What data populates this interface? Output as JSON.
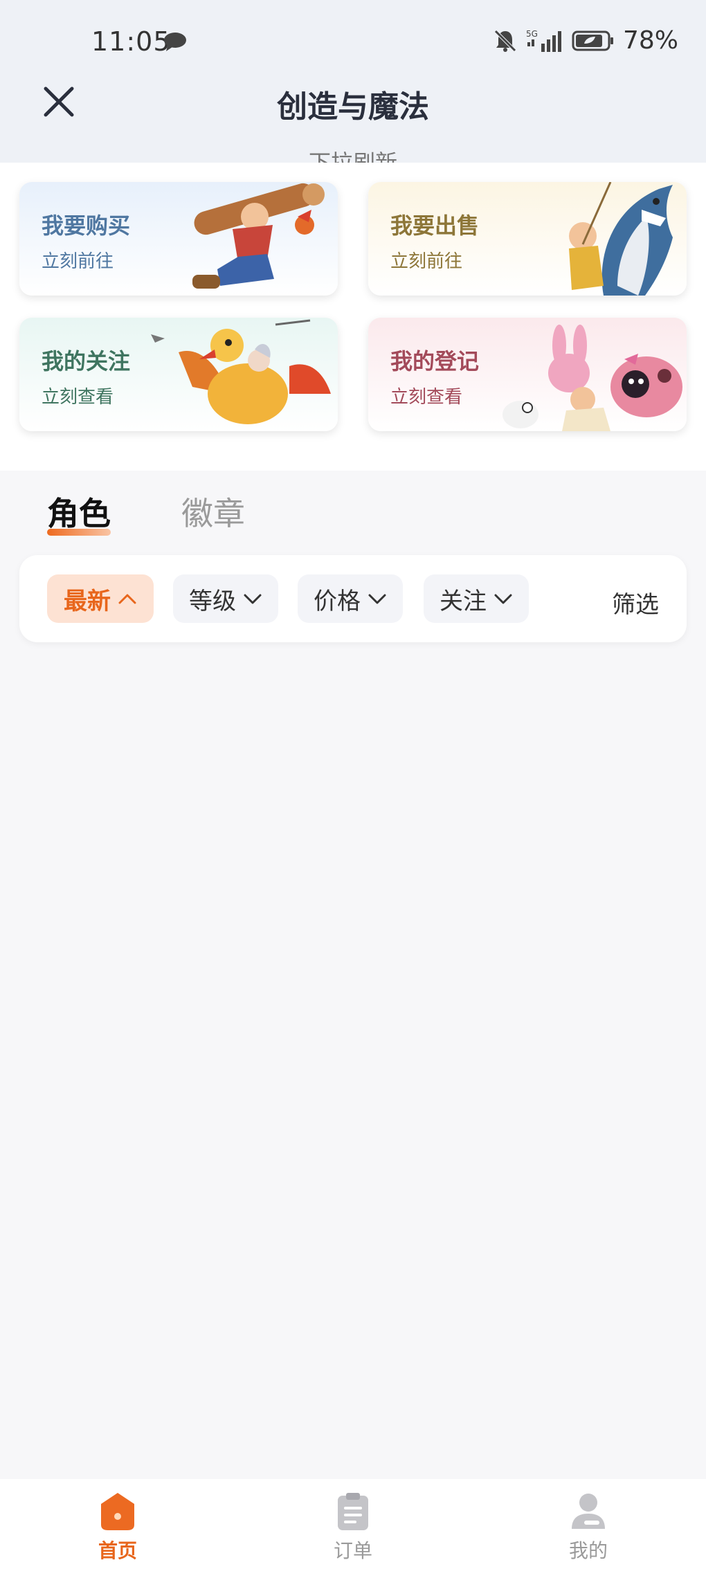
{
  "status_bar": {
    "time": "11:05",
    "network": "5G",
    "battery": "78%",
    "icons": [
      "message-icon",
      "bell-mute-icon",
      "signal-icon",
      "battery-icon"
    ]
  },
  "header": {
    "title": "创造与魔法",
    "close_icon": "close-icon",
    "pull_hint": "下拉刷新"
  },
  "cards": [
    {
      "title": "我要购买",
      "subtitle": "立刻前往",
      "accent": "#4f77a1"
    },
    {
      "title": "我要出售",
      "subtitle": "立刻前往",
      "accent": "#8d7638"
    },
    {
      "title": "我的关注",
      "subtitle": "立刻查看",
      "accent": "#3f7560"
    },
    {
      "title": "我的登记",
      "subtitle": "立刻查看",
      "accent": "#a34a5a"
    }
  ],
  "tabs": [
    {
      "label": "角色",
      "active": true
    },
    {
      "label": "徽章",
      "active": false
    }
  ],
  "filters": {
    "chips": [
      {
        "label": "最新",
        "active": true,
        "icon": "chevron-up-icon"
      },
      {
        "label": "等级",
        "active": false,
        "icon": "chevron-down-icon"
      },
      {
        "label": "价格",
        "active": false,
        "icon": "chevron-down-icon"
      },
      {
        "label": "关注",
        "active": false,
        "icon": "chevron-down-icon"
      }
    ],
    "filter_label": "筛选"
  },
  "bottom_nav": [
    {
      "label": "首页",
      "icon": "home-icon",
      "active": true
    },
    {
      "label": "订单",
      "icon": "clipboard-icon",
      "active": false
    },
    {
      "label": "我的",
      "icon": "user-icon",
      "active": false
    }
  ],
  "colors": {
    "accent": "#e8661c",
    "header_bg": "#eef1f6",
    "page_bg": "#f7f7f9"
  }
}
